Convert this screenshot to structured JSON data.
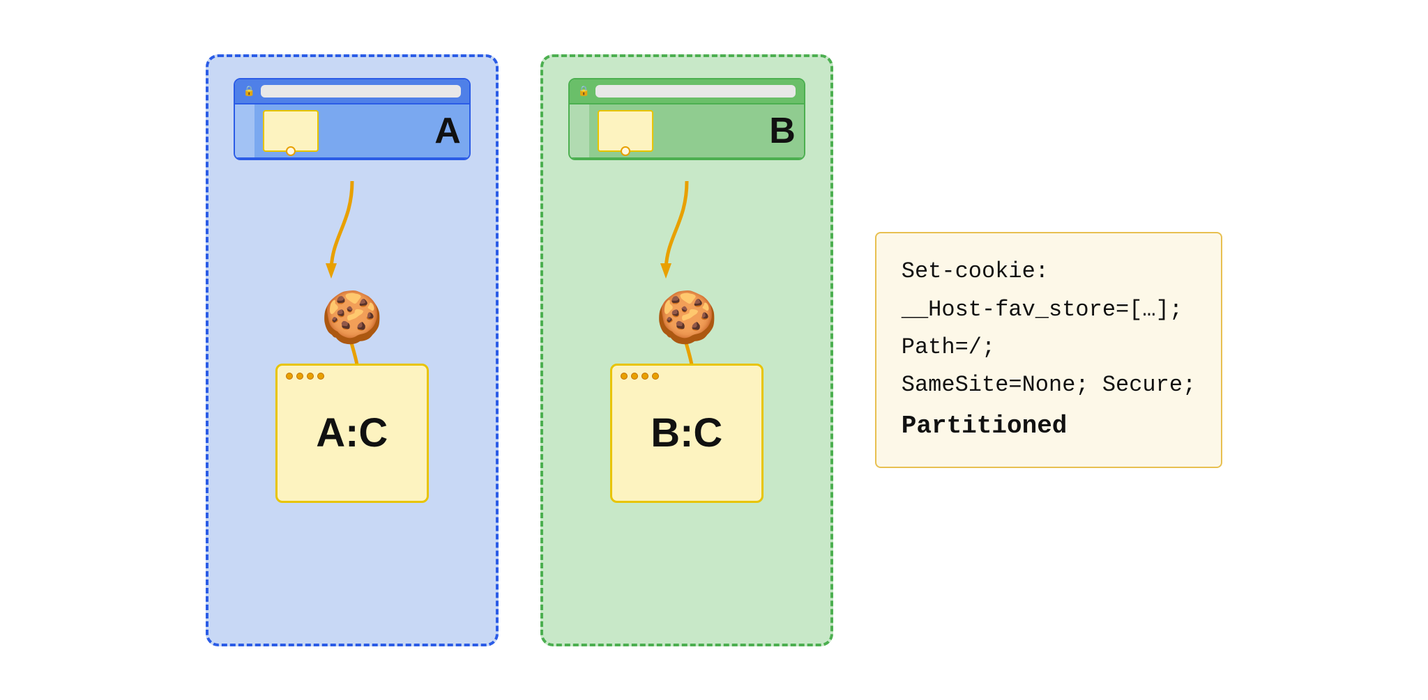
{
  "left_partition": {
    "color": "blue",
    "browser_label": "A",
    "storage_label": "A:C",
    "border_color": "#2b5ce6",
    "bg_color": "#c8d8f5"
  },
  "right_partition": {
    "color": "green",
    "browser_label": "B",
    "storage_label": "B:C",
    "border_color": "#4caf50",
    "bg_color": "#c8e8c8"
  },
  "code_block": {
    "line1": "Set-cookie:",
    "line2": "__Host-fav_store=[…];",
    "line3": "Path=/;",
    "line4": "SameSite=None; Secure;",
    "line5": "Partitioned"
  }
}
